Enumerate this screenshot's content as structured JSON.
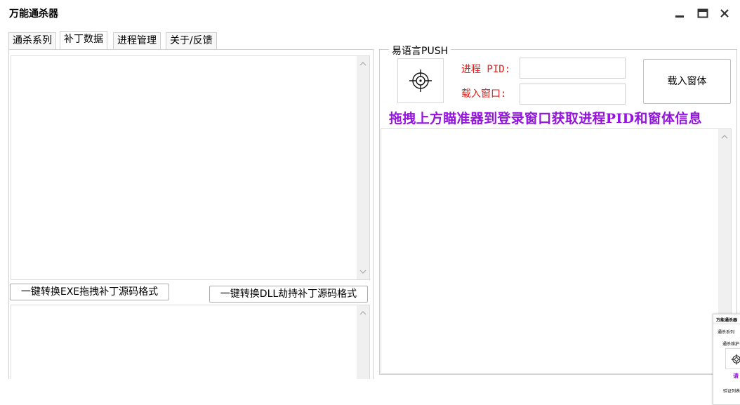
{
  "window": {
    "title": "万能通杀器",
    "controls": [
      "minimize",
      "maximize",
      "close"
    ]
  },
  "tabs": [
    {
      "label": "通杀系列",
      "active": false
    },
    {
      "label": "补丁数据",
      "active": true
    },
    {
      "label": "进程管理",
      "active": false
    },
    {
      "label": "关于/反馈",
      "active": false
    }
  ],
  "left_panel": {
    "top_textarea_value": "",
    "button_exe": "一键转换EXE拖拽补丁源码格式",
    "button_dll": "一键转换DLL劫持补丁源码格式",
    "bottom_textarea_value": ""
  },
  "push_group": {
    "title": "易语言PUSH",
    "crosshair_icon": "crosshair-icon",
    "pid_label": "进程 PID:",
    "pid_value": "",
    "window_label": "载入窗口:",
    "window_value": "",
    "load_button": "载入窗体",
    "hint": "拖拽上方瞄准器到登录窗口获取进程PID和窗体信息",
    "output_value": ""
  },
  "mini_window": {
    "title": "万能通杀器",
    "tab": "通杀系列",
    "group": "通杀维护",
    "hint_fragment": "请",
    "list_label": "验证列表"
  },
  "colors": {
    "hint": "#9413e0",
    "field_label": "#e0201d",
    "border": "#d0d0d0"
  }
}
